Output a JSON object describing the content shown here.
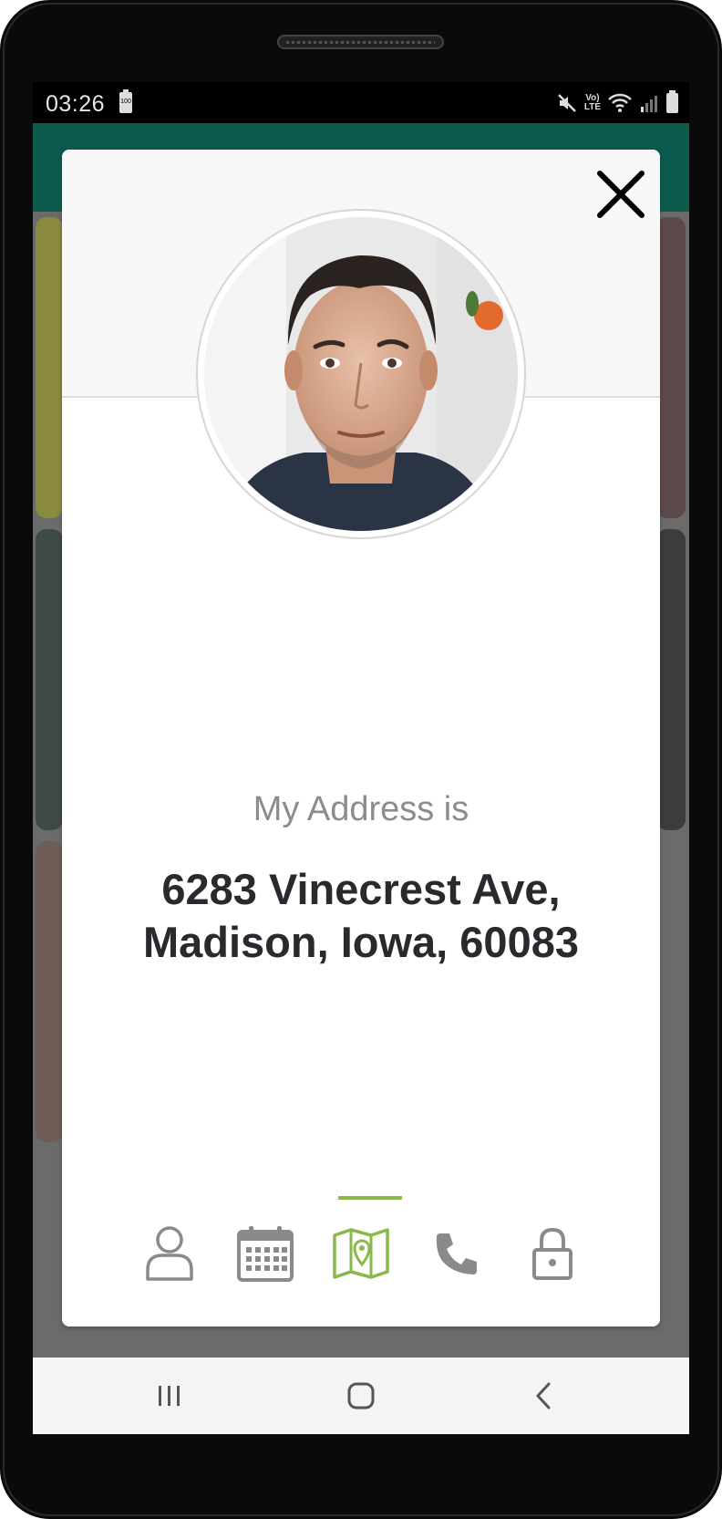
{
  "status": {
    "time": "03:26",
    "battery_label": "100",
    "network_label_top": "Vo)",
    "network_label_bottom": "LTE"
  },
  "modal": {
    "label": "My Address is",
    "value": "6283 Vinecrest Ave, Madison, Iowa, 60083",
    "tabs": [
      {
        "name": "person",
        "icon": "user-icon",
        "active": false
      },
      {
        "name": "calendar",
        "icon": "calendar-icon",
        "active": false
      },
      {
        "name": "map",
        "icon": "map-icon",
        "active": true
      },
      {
        "name": "phone",
        "icon": "phone-icon",
        "active": false
      },
      {
        "name": "lock",
        "icon": "lock-icon",
        "active": false
      }
    ]
  },
  "colors": {
    "accent": "#8ab84a",
    "header": "#0d5a4f",
    "icon_inactive": "#8a8a8a",
    "value_text": "#2a2a2e",
    "label_text": "#8c8c8c"
  },
  "navbar": {
    "buttons": [
      "recent-apps",
      "home",
      "back"
    ]
  }
}
